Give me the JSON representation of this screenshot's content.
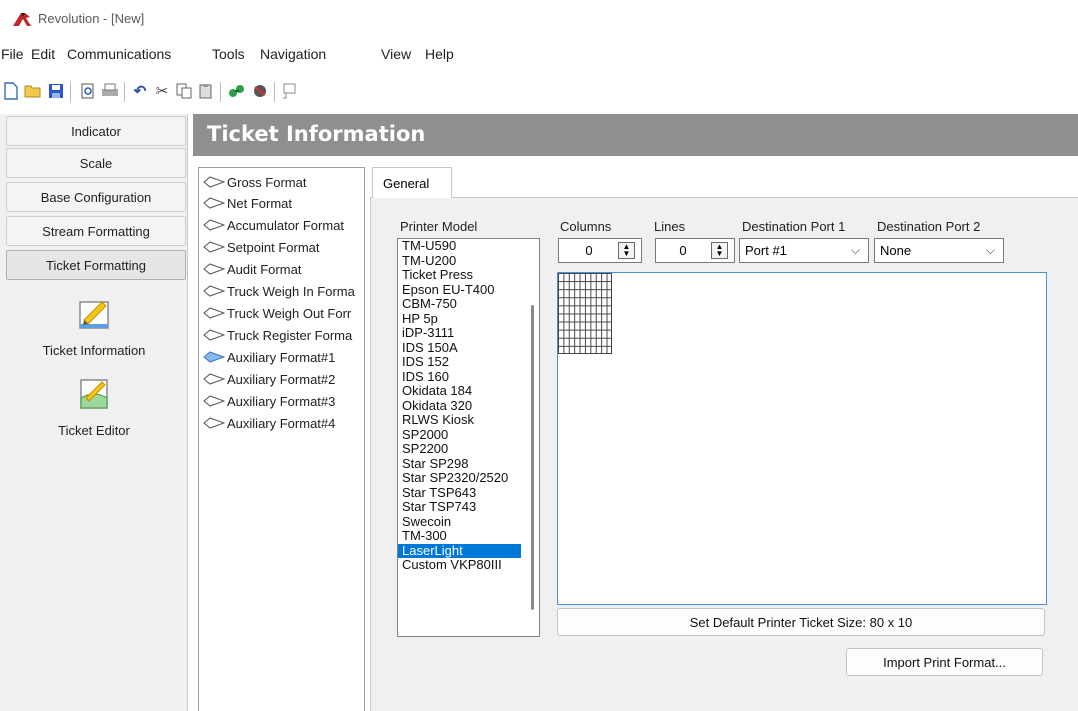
{
  "window": {
    "title": "Revolution - [New]"
  },
  "menu": [
    "File",
    "Edit",
    "Communications",
    "Tools",
    "Navigation",
    "View",
    "Help"
  ],
  "toolbar": [
    "new-file-icon",
    "open-folder-icon",
    "save-icon",
    "print-preview-icon",
    "print-icon",
    "undo-icon",
    "cut-icon",
    "copy-icon",
    "paste-icon",
    "connect-icon",
    "disconnect-icon",
    "comment-icon"
  ],
  "nav": {
    "buttons": [
      "Indicator",
      "Scale",
      "Base Configuration",
      "Stream Formatting",
      "Ticket Formatting"
    ],
    "tiles": [
      "Ticket Information",
      "Ticket Editor"
    ]
  },
  "page": {
    "title": "Ticket Information"
  },
  "formats": [
    "Gross Format",
    "Net Format",
    "Accumulator Format",
    "Setpoint Format",
    "Audit Format",
    "Truck Weigh In Forma",
    "Truck Weigh Out Forr",
    "Truck Register Forma",
    "Auxiliary Format#1",
    "Auxiliary Format#2",
    "Auxiliary Format#3",
    "Auxiliary Format#4"
  ],
  "formats_selected": "Auxiliary Format#1",
  "tab": {
    "general": "General"
  },
  "general": {
    "printer_model_label": "Printer Model",
    "printers": [
      "TM-U590",
      "TM-U200",
      "Ticket Press",
      "Epson EU-T400",
      "CBM-750",
      "HP 5p",
      "iDP-3111",
      "IDS 150A",
      "IDS 152",
      "IDS 160",
      "Okidata 184",
      "Okidata 320",
      "RLWS Kiosk",
      "SP2000",
      "SP2200",
      "Star SP298",
      "Star SP2320/2520",
      "Star TSP643",
      "Star TSP743",
      "Swecoin",
      "TM-300",
      "LaserLight",
      "Custom VKP80III"
    ],
    "selected_printer": "LaserLight",
    "columns_label": "Columns",
    "columns_value": "0",
    "lines_label": "Lines",
    "lines_value": "0",
    "dest_port1_label": "Destination Port 1",
    "dest_port1_value": "Port #1",
    "dest_port2_label": "Destination Port 2",
    "dest_port2_value": "None",
    "set_default_button": "Set Default Printer Ticket Size:  80 x 10",
    "import_button": "Import Print Format..."
  },
  "colors": {
    "selection": "#0078d7",
    "header": "#8f8f8f",
    "canvas_border": "#4a90d9"
  }
}
